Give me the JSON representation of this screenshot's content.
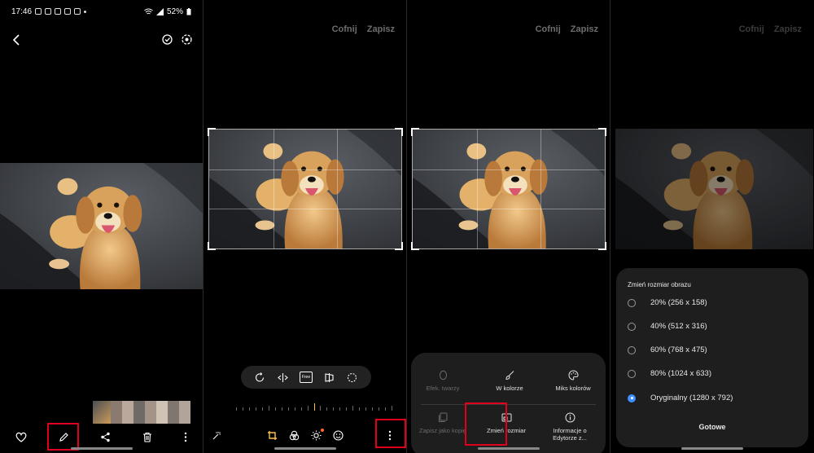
{
  "status_bar": {
    "time": "17:46",
    "battery": "52%"
  },
  "editor": {
    "undo_label": "Cofnij",
    "save_label": "Zapisz"
  },
  "tools": {
    "free_label": "Free"
  },
  "more_menu": {
    "items": [
      {
        "label": "Efek. twarzy",
        "icon": "face-icon",
        "enabled": false
      },
      {
        "label": "W kolorze",
        "icon": "brush-icon",
        "enabled": true
      },
      {
        "label": "Miks kolorów",
        "icon": "palette-icon",
        "enabled": true
      },
      {
        "label": "Zapisz jako kopię",
        "icon": "copy-icon",
        "enabled": false
      },
      {
        "label": "Zmień rozmiar",
        "icon": "resize-icon",
        "enabled": true
      },
      {
        "label": "Informacje o Edytorze z...",
        "icon": "info-icon",
        "enabled": true
      }
    ]
  },
  "resize_dialog": {
    "title": "Zmień rozmiar obrazu",
    "options": [
      "20% (256 x 158)",
      "40% (512 x 316)",
      "60% (768 x 475)",
      "80% (1024 x 633)",
      "Oryginalny (1280 x 792)"
    ],
    "selected_index": 4,
    "done_label": "Gotowe"
  },
  "colors": {
    "highlight": "#e0001b",
    "accent": "#3e91ff",
    "edit_badge": "#ff6a2a"
  }
}
